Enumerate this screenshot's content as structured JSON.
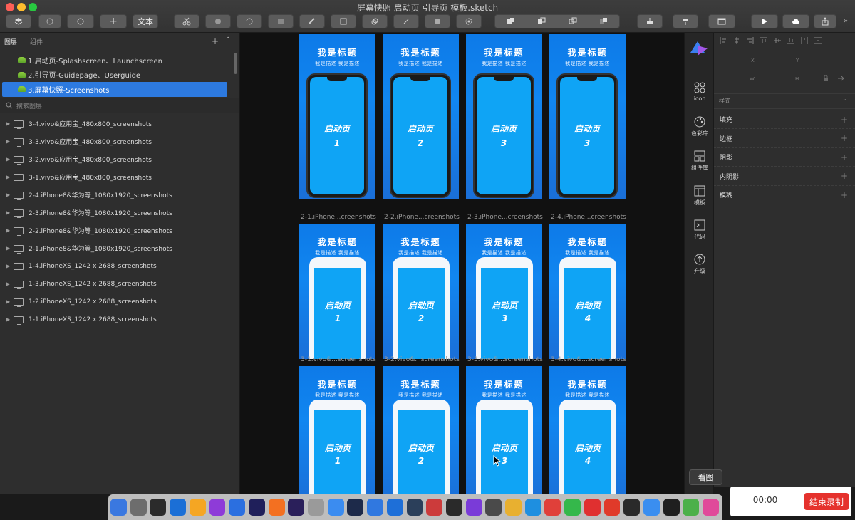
{
  "window": {
    "title": "屏幕快照 启动页 引导页 模板.sketch"
  },
  "toolbar": {
    "text_style_label": "文本"
  },
  "left_panel": {
    "tabs": [
      "图层",
      "组件"
    ],
    "pages": [
      {
        "label": "1.启动页-Splashscreen、Launchscreen",
        "selected": false
      },
      {
        "label": "2.引导页-Guidepage、Userguide",
        "selected": false
      },
      {
        "label": "3.屏幕快照-Screenshots",
        "selected": true
      }
    ],
    "search_placeholder": "搜索图层",
    "layers": [
      "3-4.vivo&应用宝_480x800_screenshots",
      "3-3.vivo&应用宝_480x800_screenshots",
      "3-2.vivo&应用宝_480x800_screenshots",
      "3-1.vivo&应用宝_480x800_screenshots",
      "2-4.iPhone8&华为等_1080x1920_screenshots",
      "2-3.iPhone8&华为等_1080x1920_screenshots",
      "2-2.iPhone8&华为等_1080x1920_screenshots",
      "2-1.iPhone8&华为等_1080x1920_screenshots",
      "1-4.iPhoneXS_1242 x 2688_screenshots",
      "1-3.iPhoneXS_1242 x 2688_screenshots",
      "1-2.iPhoneXS_1242 x 2688_screenshots",
      "1-1.iPhoneXS_1242 x 2688_screenshots"
    ]
  },
  "canvas": {
    "artboard_title": "我是标题",
    "artboard_subtitle": "我是描述  我是描述",
    "screen_label": "启动页",
    "row1_numbers": [
      "1",
      "2",
      "3",
      "3"
    ],
    "row2_numbers": [
      "1",
      "2",
      "3",
      "4"
    ],
    "row3_numbers": [
      "1",
      "2",
      "3",
      "4"
    ],
    "row2_captions": [
      "2-1.iPhone...creenshots",
      "2-2.iPhone...creenshots",
      "2-3.iPhone...creenshots",
      "2-4.iPhone...creenshots"
    ],
    "row3_captions": [
      "3-1.vivo&...screenshots",
      "3-2.vivo&...screenshots",
      "3-3.vivo&...screenshots",
      "3-4.vivo&...screenshots"
    ]
  },
  "plugin_strip": {
    "items": [
      "icon",
      "色彩库",
      "组件库",
      "模板",
      "代码",
      "升级"
    ]
  },
  "inspector": {
    "labels": {
      "x": "X",
      "y": "Y",
      "w": "W",
      "h": "H"
    },
    "style_heading": "样式",
    "sections": [
      "填充",
      "边框",
      "阴影",
      "内阴影",
      "模糊"
    ]
  },
  "tooltip": "看图",
  "recorder": {
    "time": "00:00",
    "stop_label": "结束录制"
  },
  "colors": {
    "selection": "#2d7ae0",
    "artboard_blue": "#1186f0",
    "record_red": "#e5322d"
  }
}
